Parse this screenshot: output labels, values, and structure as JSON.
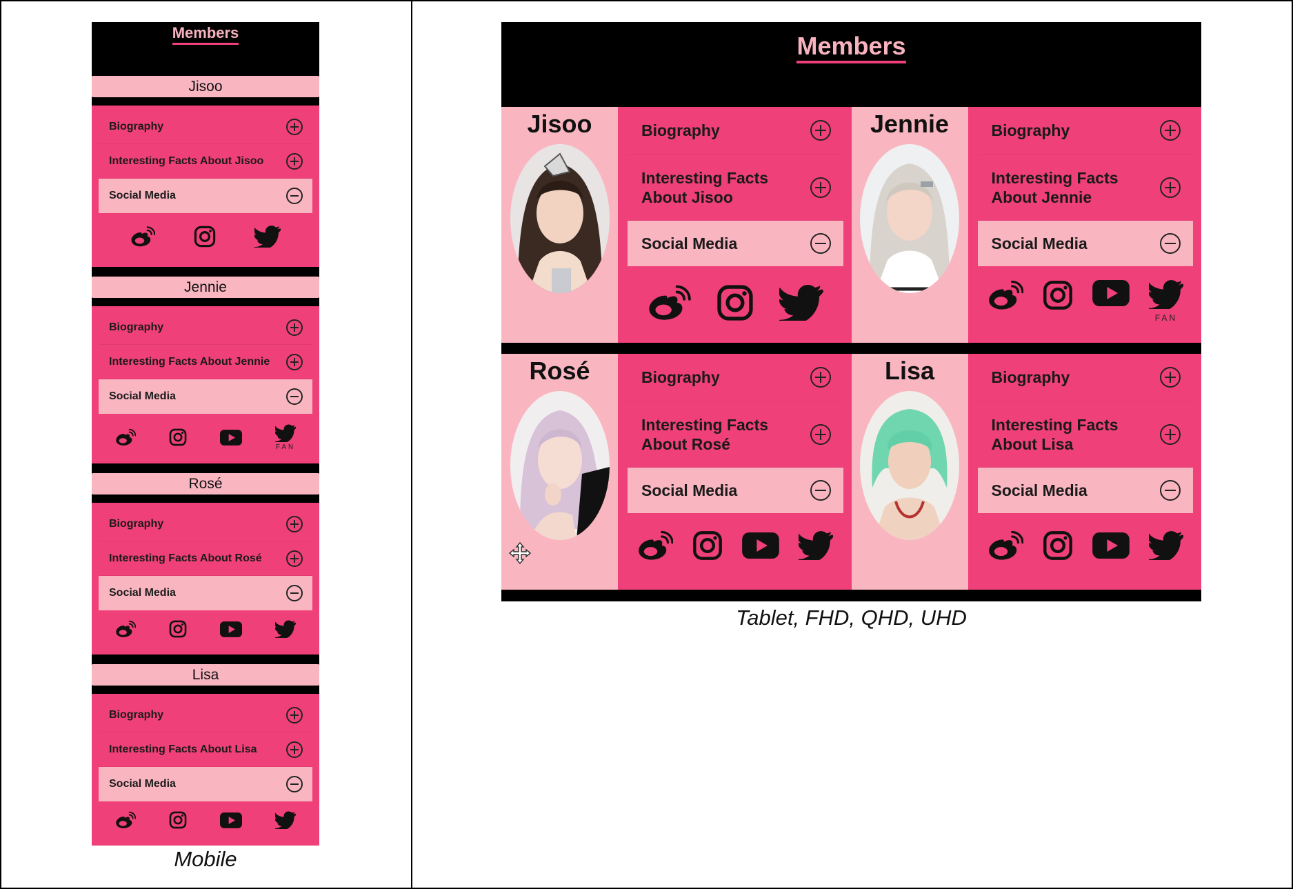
{
  "mobile": {
    "title": "Members",
    "caption": "Mobile",
    "members": [
      {
        "name": "Jisoo",
        "rows": [
          "Biography",
          "Interesting Facts About Jisoo",
          "Social Media"
        ],
        "icons": [
          "weibo-icon",
          "instagram-icon",
          "twitter-icon"
        ]
      },
      {
        "name": "Jennie",
        "rows": [
          "Biography",
          "Interesting Facts About Jennie",
          "Social Media"
        ],
        "icons": [
          "weibo-icon",
          "instagram-icon",
          "youtube-icon",
          "twitter-icon"
        ],
        "fan_label": "FAN"
      },
      {
        "name": "Rosé",
        "rows": [
          "Biography",
          "Interesting Facts About Rosé",
          "Social Media"
        ],
        "icons": [
          "weibo-icon",
          "instagram-icon",
          "youtube-icon",
          "twitter-icon"
        ]
      },
      {
        "name": "Lisa",
        "rows": [
          "Biography",
          "Interesting Facts About Lisa",
          "Social Media"
        ],
        "icons": [
          "weibo-icon",
          "instagram-icon",
          "youtube-icon",
          "twitter-icon"
        ]
      }
    ]
  },
  "desktop": {
    "title": "Members",
    "caption": "Tablet, FHD, QHD, UHD",
    "members": [
      {
        "name": "Jisoo",
        "biography": "Biography",
        "facts_line1": "Interesting Facts",
        "facts_line2": "About Jisoo",
        "social": "Social Media"
      },
      {
        "name": "Jennie",
        "biography": "Biography",
        "facts_line1": "Interesting Facts",
        "facts_line2": "About Jennie",
        "social": "Social Media",
        "fan_label": "FAN"
      },
      {
        "name": "Rosé",
        "biography": "Biography",
        "facts_line1": "Interesting Facts",
        "facts_line2": "About Rosé",
        "social": "Social Media"
      },
      {
        "name": "Lisa",
        "biography": "Biography",
        "facts_line1": "Interesting Facts",
        "facts_line2": "About Lisa",
        "social": "Social Media"
      }
    ]
  },
  "colors": {
    "accent": "#f04079",
    "light_pink": "#f9b6c1",
    "background": "#000000"
  }
}
